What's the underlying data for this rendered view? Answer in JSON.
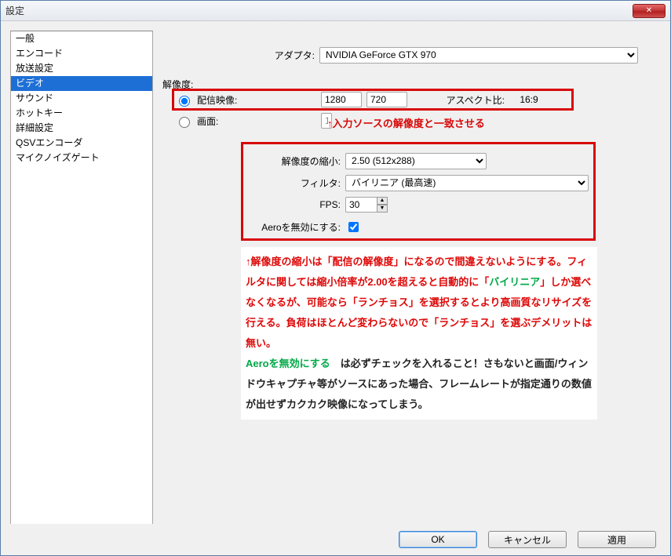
{
  "window": {
    "title": "設定"
  },
  "nav": {
    "items": [
      {
        "label": "一般"
      },
      {
        "label": "エンコード"
      },
      {
        "label": "放送設定"
      },
      {
        "label": "ビデオ",
        "selected": true
      },
      {
        "label": "サウンド"
      },
      {
        "label": "ホットキー"
      },
      {
        "label": "詳細設定"
      },
      {
        "label": "QSVエンコーダ"
      },
      {
        "label": "マイクノイズゲート"
      }
    ]
  },
  "video": {
    "adapter_label": "アダプタ:",
    "adapter_value": "NVIDIA GeForce GTX 970",
    "resolution_label": "解像度:",
    "radio_stream_label": "配信映像:",
    "width": "1280",
    "height": "720",
    "aspect_label": "アスペクト比:",
    "aspect_value": "16:9",
    "radio_screen_label": "画面:",
    "screen_value": "1",
    "scale_label": "解像度の縮小:",
    "scale_value": "2.50 (512x288)",
    "filter_label": "フィルタ:",
    "filter_value": "バイリニア (最高速)",
    "fps_label": "FPS:",
    "fps_value": "30",
    "aero_label": "Aeroを無効にする:",
    "aero_checked": true
  },
  "annotations": {
    "a1": "↑入力ソースの解像度と一致させる",
    "notes_html": {
      "p1_pre": "↑解像度の縮小は「配信の解像度」になるので間違えないようにする。フィルタに関しては縮小倍率が2.00を超えると自動的に「",
      "p1_green": "バイリニア",
      "p1_post": "」しか選べなくなるが、可能なら「ランチョス」を選択するとより高画質なリサイズを行える。負荷はほとんど変わらないので「ランチョス」を選ぶデメリットは無い。",
      "p2_green": "Aeroを無効にする",
      "p2_black": "　は必ずチェックを入れること！さもないと画面/ウィンドウキャプチャ等がソースにあった場合、フレームレートが指定通りの数値が出せずカクカク映像になってしまう。"
    }
  },
  "buttons": {
    "ok": "OK",
    "cancel": "キャンセル",
    "apply": "適用"
  }
}
